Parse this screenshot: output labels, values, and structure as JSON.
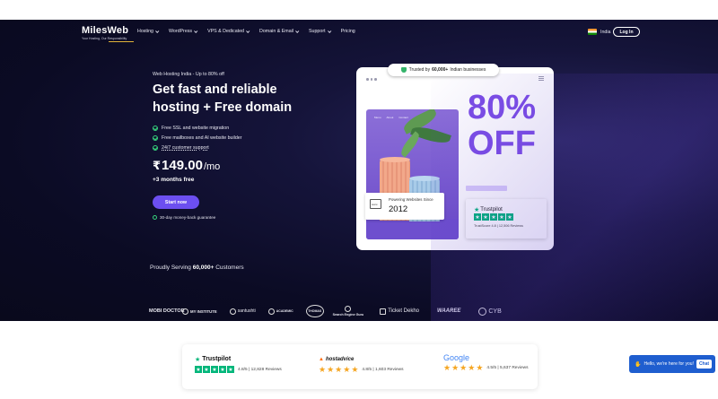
{
  "nav": {
    "brand": "MilesWeb",
    "tagline": "Your Hosting, Our Responsibility",
    "menu": [
      {
        "label": "Hosting",
        "dropdown": true
      },
      {
        "label": "WordPress",
        "dropdown": true
      },
      {
        "label": "VPS & Dedicated",
        "dropdown": true
      },
      {
        "label": "Domain & Email",
        "dropdown": true
      },
      {
        "label": "Support",
        "dropdown": true
      },
      {
        "label": "Pricing",
        "dropdown": false
      }
    ],
    "region": "India",
    "login_label": "Log In"
  },
  "hero": {
    "eyebrow": "Web Hosting India - Up to 80% off",
    "headline_line1": "Get fast and reliable",
    "headline_line2": "hosting + Free domain",
    "features": [
      "Free SSL and website migration",
      "Free mailboxes and AI website builder",
      "24/7 customer support"
    ],
    "currency": "₹",
    "price": "149.00",
    "period": "/mo",
    "bonus": "+3 months free",
    "cta_label": "Start now",
    "guarantee": "30-day money-back guarantee"
  },
  "card": {
    "trust_prefix": "Trusted by",
    "trust_count": "60,000+",
    "trust_suffix": "Indian businesses",
    "mini_menu": [
      "Menu",
      "About",
      "Contact"
    ],
    "discount": "80%",
    "discount_word": "OFF",
    "since_label": "Powering Websites Since",
    "since_year": "2012",
    "trustpilot_brand": "Trustpilot",
    "trustpilot_score": "TrustScore 4.8 | 12,506 Reviews"
  },
  "customers": {
    "prefix": "Proudly Serving",
    "count": "60,000+",
    "suffix": "Customers",
    "logos": [
      "MOBI DOCTOR",
      "MY INSTITUTE",
      "santushti",
      "ACADEMIC",
      "THOMAS",
      "Search Engine Guru",
      "Ticket Dekho",
      "WAAREE",
      "CYB"
    ]
  },
  "ratings": [
    {
      "brand": "Trustpilot",
      "rating": "4.8/5",
      "reviews": "12,828",
      "reviews_label": "Reviews"
    },
    {
      "brand": "hostadvice",
      "rating": "4.8/5",
      "reviews": "1,603",
      "reviews_label": "Reviews"
    },
    {
      "brand": "Google",
      "rating": "4.5/5",
      "reviews": "5,637",
      "reviews_label": "Reviews"
    }
  ],
  "chat": {
    "message": "Hello, we're here for you!",
    "button": "Chat"
  },
  "colors": {
    "accent": "#6c4ff0",
    "discount": "#7c4de6",
    "trustpilot_green": "#00b67a",
    "chat_blue": "#1f5ecf"
  }
}
